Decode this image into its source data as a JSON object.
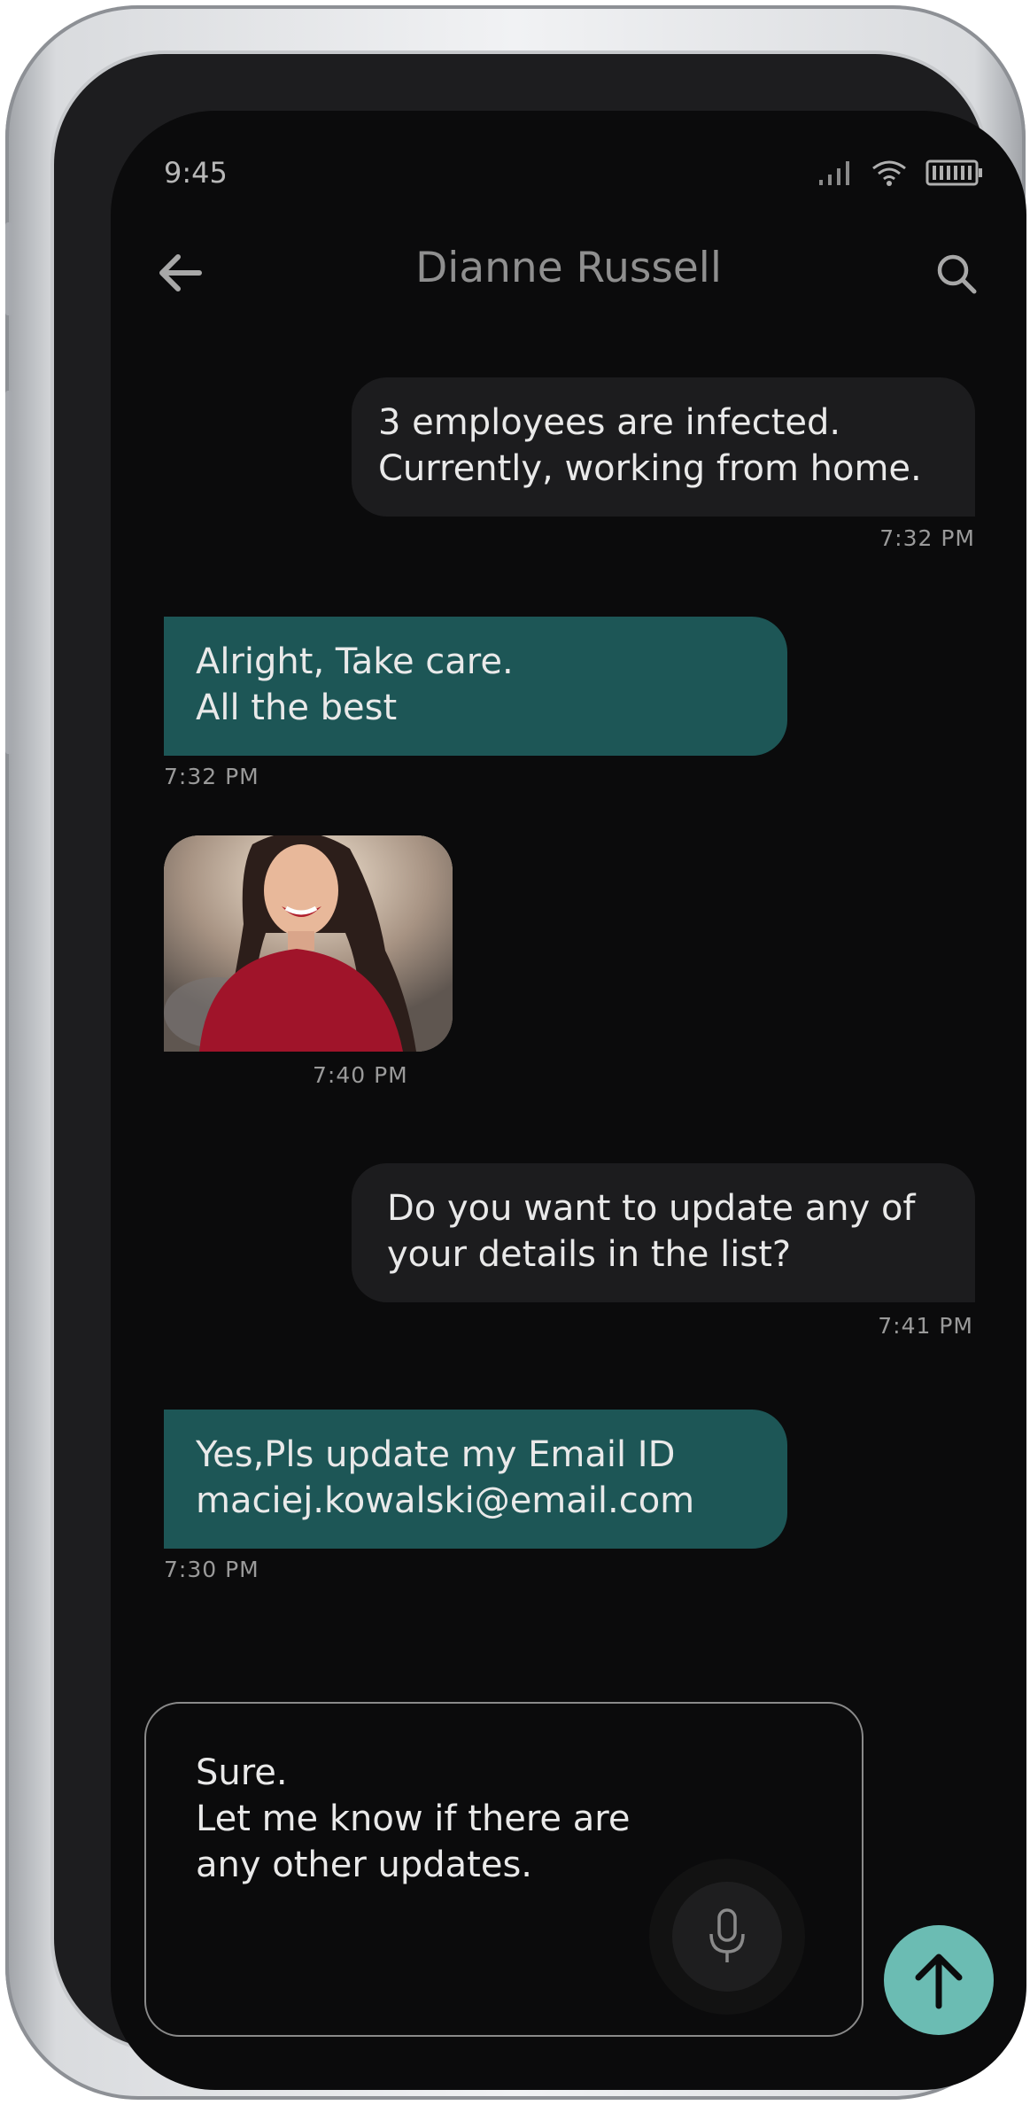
{
  "status_bar": {
    "time": "9:45",
    "icons": [
      "signal-icon",
      "wifi-icon",
      "battery-icon"
    ]
  },
  "header": {
    "title": "Dianne Russell",
    "back_icon": "arrow-left-icon",
    "search_icon": "search-icon"
  },
  "messages": [
    {
      "direction": "incoming",
      "lines": [
        "3 employees are infected.",
        "Currently, working from home."
      ],
      "time": "7:32 PM"
    },
    {
      "direction": "outgoing",
      "lines": [
        "Alright, Take care.",
        "All the best"
      ],
      "time": "7:32 PM"
    },
    {
      "direction": "outgoing",
      "type": "image",
      "image": "photo of smiling woman",
      "time": "7:40 PM"
    },
    {
      "direction": "incoming",
      "lines": [
        "Do you want to update any of",
        "your details in the list?"
      ],
      "time": "7:41 PM"
    },
    {
      "direction": "outgoing",
      "lines": [
        "Yes,Pls update my Email ID",
        "maciej.kowalski@email.com"
      ],
      "time": "7:30 PM"
    }
  ],
  "composer": {
    "text": "Sure.\nLet me know if there are\nany other updates.",
    "mic_icon": "microphone-icon",
    "send_icon": "arrow-up-icon"
  },
  "colors": {
    "screen_bg": "#0b0b0c",
    "incoming_bubble": "#1c1c1e",
    "outgoing_bubble": "#1d5656",
    "send_button": "#6bbcb3"
  }
}
